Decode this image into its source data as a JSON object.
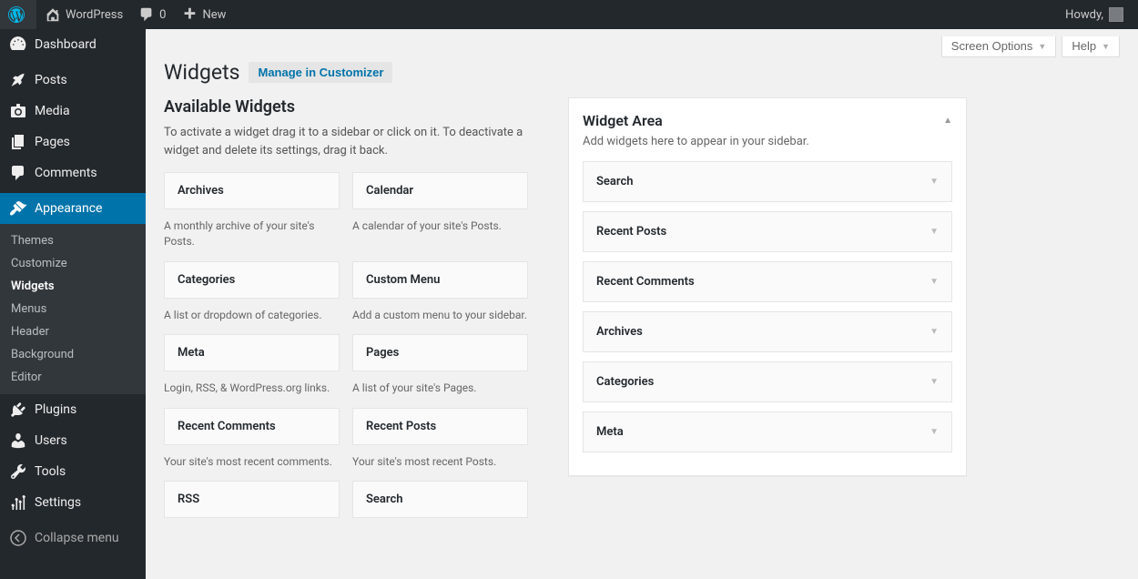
{
  "adminbar": {
    "site_title": "WordPress",
    "comment_count": "0",
    "new_label": "New",
    "howdy": "Howdy,"
  },
  "sidebar": {
    "items": [
      {
        "label": "Dashboard"
      },
      {
        "label": "Posts"
      },
      {
        "label": "Media"
      },
      {
        "label": "Pages"
      },
      {
        "label": "Comments"
      },
      {
        "label": "Appearance"
      },
      {
        "label": "Plugins"
      },
      {
        "label": "Users"
      },
      {
        "label": "Tools"
      },
      {
        "label": "Settings"
      }
    ],
    "appearance_submenu": [
      "Themes",
      "Customize",
      "Widgets",
      "Menus",
      "Header",
      "Background",
      "Editor"
    ],
    "collapse": "Collapse menu"
  },
  "top_actions": {
    "screen_options": "Screen Options",
    "help": "Help"
  },
  "page": {
    "title": "Widgets",
    "customizer_label": "Manage in Customizer",
    "available_heading": "Available Widgets",
    "available_desc": "To activate a widget drag it to a sidebar or click on it. To deactivate a widget and delete its settings, drag it back."
  },
  "available_widgets": [
    {
      "title": "Archives",
      "desc": "A monthly archive of your site's Posts."
    },
    {
      "title": "Calendar",
      "desc": "A calendar of your site's Posts."
    },
    {
      "title": "Categories",
      "desc": "A list or dropdown of categories."
    },
    {
      "title": "Custom Menu",
      "desc": "Add a custom menu to your sidebar."
    },
    {
      "title": "Meta",
      "desc": "Login, RSS, & WordPress.org links."
    },
    {
      "title": "Pages",
      "desc": "A list of your site's Pages."
    },
    {
      "title": "Recent Comments",
      "desc": "Your site's most recent comments."
    },
    {
      "title": "Recent Posts",
      "desc": "Your site's most recent Posts."
    },
    {
      "title": "RSS",
      "desc": ""
    },
    {
      "title": "Search",
      "desc": ""
    }
  ],
  "widget_area": {
    "title": "Widget Area",
    "desc": "Add widgets here to appear in your sidebar.",
    "widgets": [
      "Search",
      "Recent Posts",
      "Recent Comments",
      "Archives",
      "Categories",
      "Meta"
    ]
  }
}
